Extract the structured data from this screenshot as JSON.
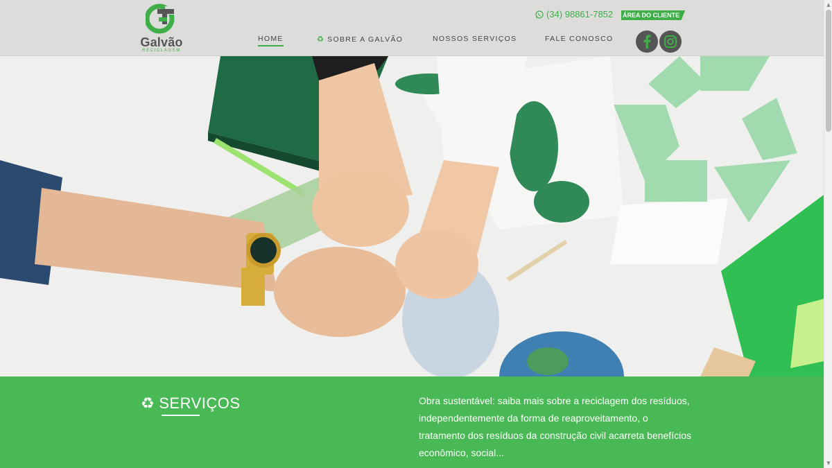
{
  "brand": {
    "name": "Galvão",
    "tagline": "RECICLAGEM",
    "accent_color": "#3fae49"
  },
  "header": {
    "phone": "(34) 98861-7852",
    "client_area": "ÁREA DO CLIENTE"
  },
  "nav": {
    "items": [
      {
        "label": "HOME",
        "active": true
      },
      {
        "label": "SOBRE A GALVÃO",
        "icon": "recycle-icon"
      },
      {
        "label": "NOSSOS SERVIÇOS"
      },
      {
        "label": "FALE CONOSCO"
      }
    ]
  },
  "social": {
    "facebook": "facebook-icon",
    "instagram": "instagram-icon"
  },
  "services": {
    "title": "SERVIÇOS",
    "description": "Obra sustentável: saiba mais sobre a reciclagem dos resíduos, independentemente da forma de reaproveitamento, o tratamento dos resíduos da construção civil acarreta benefícios econômico, social..."
  }
}
